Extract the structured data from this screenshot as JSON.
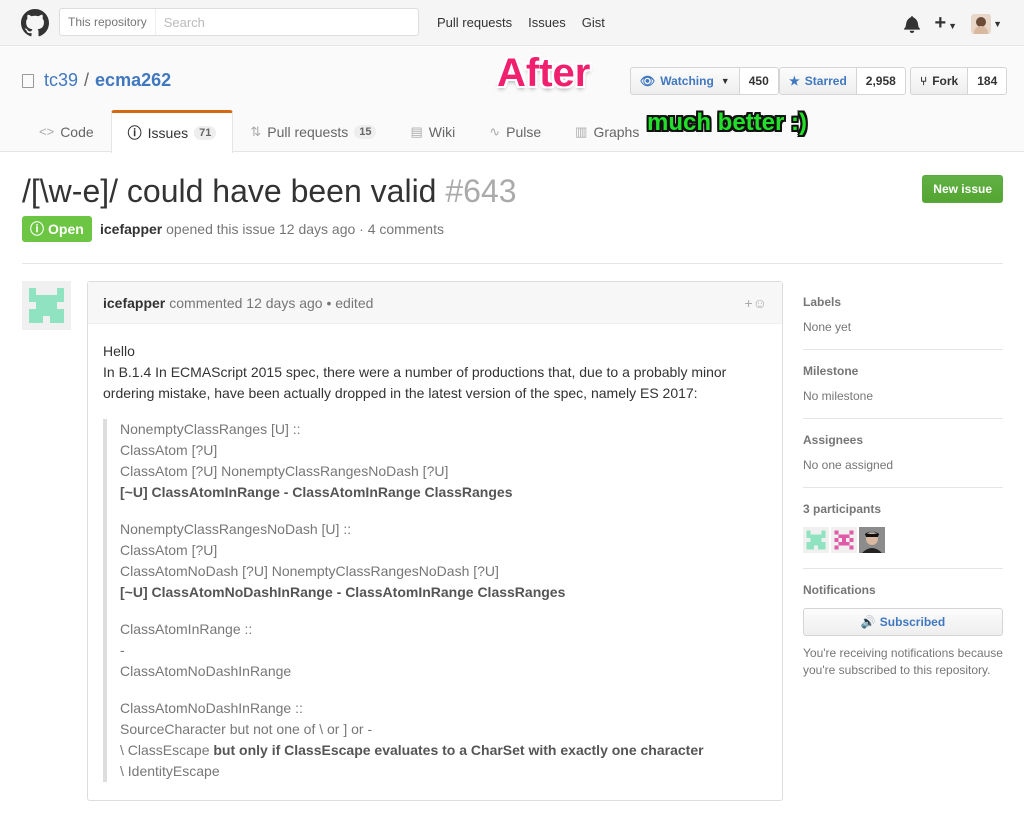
{
  "header": {
    "search_scope": "This repository",
    "search_placeholder": "Search",
    "nav": [
      "Pull requests",
      "Issues",
      "Gist"
    ]
  },
  "repo": {
    "owner": "tc39",
    "separator": "/",
    "name": "ecma262",
    "watch_label": "Watching",
    "watch_count": "450",
    "star_label": "Starred",
    "star_count": "2,958",
    "fork_label": "Fork",
    "fork_count": "184"
  },
  "annotations": {
    "after": "After",
    "better": "much better :)"
  },
  "tabs": [
    {
      "label": "Code"
    },
    {
      "label": "Issues",
      "count": "71"
    },
    {
      "label": "Pull requests",
      "count": "15"
    },
    {
      "label": "Wiki"
    },
    {
      "label": "Pulse"
    },
    {
      "label": "Graphs"
    }
  ],
  "issue": {
    "title": "/[\\w-e]/ could have been valid",
    "number": "#643",
    "new_issue_label": "New issue",
    "state": "Open",
    "author": "icefapper",
    "meta_text": "opened this issue 12 days ago · 4 comments"
  },
  "comment": {
    "author": "icefapper",
    "meta": "commented 12 days ago • edited",
    "greeting": "Hello",
    "intro": "In B.1.4 In ECMAScript 2015 spec, there were a number of productions that, due to a probably minor ordering mistake, have been actually dropped in the latest version of the spec, namely ES 2017:",
    "q1": {
      "l1": "NonemptyClassRanges [U] ::",
      "l2": "ClassAtom [?U]",
      "l3": "ClassAtom [?U] NonemptyClassRangesNoDash [?U]",
      "l4": "[~U] ClassAtomInRange - ClassAtomInRange ClassRanges"
    },
    "q2": {
      "l1": "NonemptyClassRangesNoDash [U] ::",
      "l2": "ClassAtom [?U]",
      "l3": "ClassAtomNoDash [?U] NonemptyClassRangesNoDash [?U]",
      "l4": "[~U] ClassAtomNoDashInRange - ClassAtomInRange ClassRanges"
    },
    "q3": {
      "l1": "ClassAtomInRange ::",
      "l2": "-",
      "l3": "ClassAtomNoDashInRange"
    },
    "q4": {
      "l1": "ClassAtomNoDashInRange ::",
      "l2": "SourceCharacter but not one of \\ or ] or -",
      "l3a": "\\ ClassEscape ",
      "l3b": "but only if ClassEscape evaluates to a CharSet with exactly one character",
      "l4": "\\ IdentityEscape"
    }
  },
  "sidebar": {
    "labels_h": "Labels",
    "labels_v": "None yet",
    "milestone_h": "Milestone",
    "milestone_v": "No milestone",
    "assignees_h": "Assignees",
    "assignees_v": "No one assigned",
    "participants_h": "3 participants",
    "notifications_h": "Notifications",
    "subscribed_label": "Subscribed",
    "notifications_note": "You're receiving notifications because you're subscribed to this repository."
  },
  "colors": {
    "accent": "#4078c0",
    "open_green": "#6cc644",
    "tab_orange": "#d26911",
    "after_pink": "#f0206e",
    "better_green": "#22e02a"
  }
}
